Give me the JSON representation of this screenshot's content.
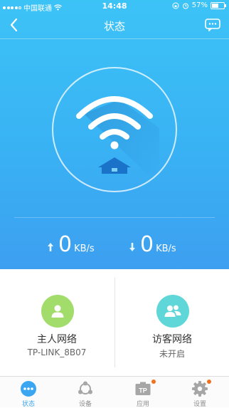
{
  "status_bar": {
    "carrier": "中国联通",
    "time": "14:48",
    "battery_pct": "57%",
    "battery_level": 0.57
  },
  "navbar": {
    "title": "状态",
    "back_icon": "chevron-left-icon",
    "message_icon": "chat-bubble-icon"
  },
  "traffic": {
    "upload": {
      "value": "0",
      "unit": "KB/s",
      "icon": "arrow-up-icon"
    },
    "download": {
      "value": "0",
      "unit": "KB/s",
      "icon": "arrow-down-icon"
    }
  },
  "networks": [
    {
      "title": "主人网络",
      "subtitle": "TP-LINK_8B07",
      "icon": "person-icon",
      "color": "#a2dc6b"
    },
    {
      "title": "访客网络",
      "subtitle": "未开启",
      "icon": "people-icon",
      "color": "#5fd6d8"
    }
  ],
  "tabs": [
    {
      "label": "状态",
      "icon": "status-dots-icon",
      "active": true
    },
    {
      "label": "设备",
      "icon": "devices-icon",
      "active": false
    },
    {
      "label": "应用",
      "icon": "apps-icon",
      "active": false,
      "badge": true
    },
    {
      "label": "设置",
      "icon": "gear-icon",
      "active": false,
      "badge": true
    }
  ],
  "colors": {
    "header_top": "#3cc3f6",
    "header_bottom": "#3d9ff0",
    "accent": "#3aa6f2",
    "badge": "#f37021",
    "house": "#1a73c8"
  }
}
